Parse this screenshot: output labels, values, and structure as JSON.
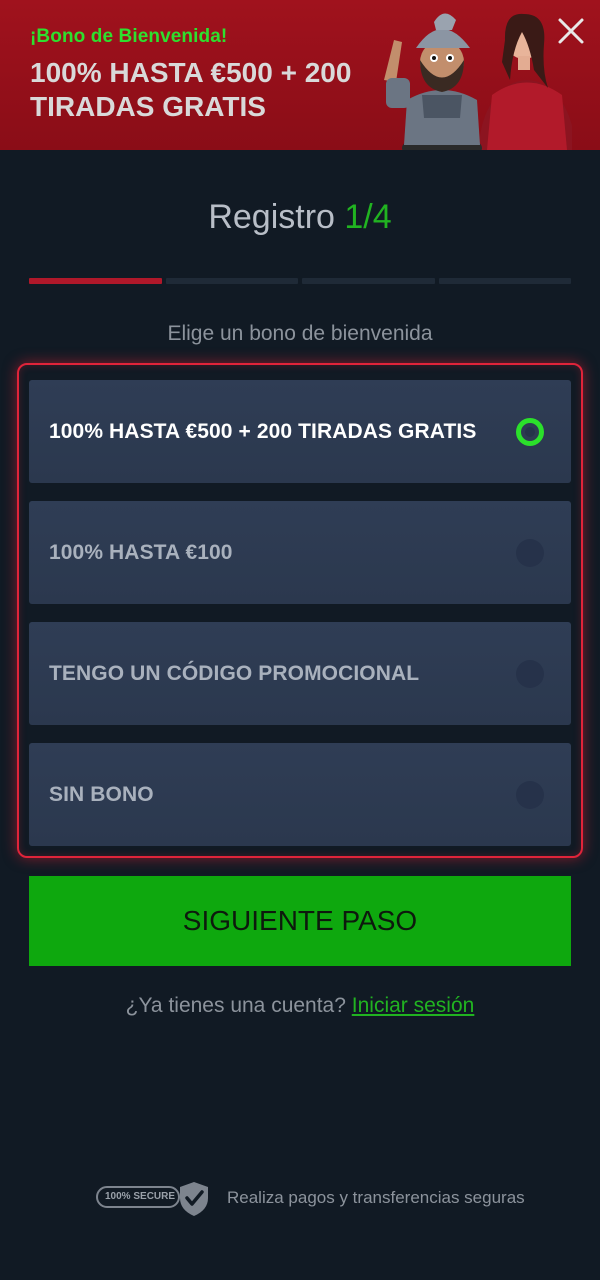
{
  "banner": {
    "kicker": "¡Bono de Bienvenida!",
    "headline": "100% HASTA €500 + 200 TIRADAS GRATIS",
    "close_icon": "close-icon"
  },
  "registration": {
    "title": "Registro",
    "step": "1/4",
    "progress": {
      "current_step": 1,
      "total_steps": 4
    },
    "subtitle": "Elige un bono de bienvenida"
  },
  "options": [
    {
      "label": "100% HASTA €500 + 200 TIRADAS GRATIS",
      "selected": true
    },
    {
      "label": "100% HASTA €100",
      "selected": false
    },
    {
      "label": "TENGO UN CÓDIGO PROMOCIONAL",
      "selected": false
    },
    {
      "label": "SIN BONO",
      "selected": false
    }
  ],
  "cta": {
    "label": "SIGUIENTE PASO"
  },
  "login": {
    "prompt": "¿Ya tienes una cuenta?",
    "link": "Iniciar sesión"
  },
  "footer": {
    "badge": "100% SECURE",
    "text": "Realiza pagos y transferencias seguras"
  },
  "colors": {
    "banner_red": "#a0121d",
    "accent_green": "#21b321",
    "button_green": "#0ea80e",
    "highlight_red": "#e0243a",
    "background": "#111a24"
  }
}
